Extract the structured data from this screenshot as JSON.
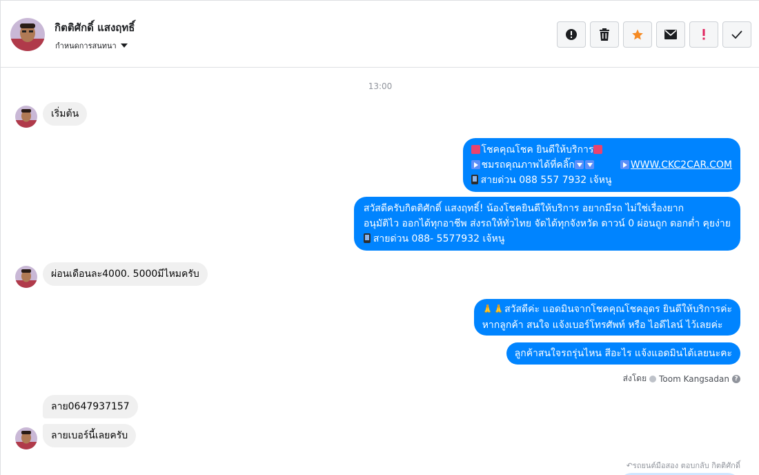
{
  "header": {
    "name": "กิตติศักดิ์ แสงฤทธิ์",
    "subtitle": "กำหนดการสนทนา",
    "actions": [
      {
        "name": "spam-button",
        "icon": "alert-circle-icon"
      },
      {
        "name": "delete-button",
        "icon": "trash-icon"
      },
      {
        "name": "star-button",
        "icon": "star-icon"
      },
      {
        "name": "mark-unread-button",
        "icon": "envelope-icon"
      },
      {
        "name": "priority-button",
        "icon": "exclamation-icon"
      },
      {
        "name": "done-button",
        "icon": "check-icon"
      }
    ]
  },
  "colors": {
    "outgoing": "#0084ff",
    "incoming": "#f0f0f0",
    "star": "#f58a23",
    "priority": "#e0245e"
  },
  "conversation": {
    "timestamp": "13:00",
    "msg_start": "เริ่มต้น",
    "auto_reply": {
      "line1": "โชคคุณโชค ยินดีให้บริการ",
      "line2a": "ชมรถคุณภาพได้ที่คลิ๊ก",
      "line2_link": "WWW.CKC2CAR.COM",
      "line3": "สายด่วน 088 557 7932 เจ้หนู"
    },
    "greeting": {
      "line1": "สวัสดีครับกิตติศักดิ์ แสงฤทธิ์! น้องโชคยินดีให้บริการ อยากมีรถ ไม่ใช่เรื่องยาก",
      "line2": "อนุมัติไว ออกได้ทุกอาชีพ ส่งรถให้ทั่วไทย จัดได้ทุกจังหวัด ดาวน์ 0  ผ่อนถูก ดอกต่ำ คุยง่าย",
      "line3": "สายด่วน 088- 5577932 เจ้หนู"
    },
    "msg_installment": "ผ่อนเดือนละ4000. 5000มีไหมครับ",
    "admin_reply": {
      "line1": "สวัสดีค่ะ แอดมินจากโชคคุณโชคอุดร ยินดีให้บริการค่ะ",
      "line2": "หากลูกค้า สนใจ แจ้งเบอร์โทรศัพท์ หรือ ไอดีไลน์  ไว้เลยค่ะ"
    },
    "admin_ask": "ลูกค้าสนใจรถรุ่นไหน สีอะไร แจ้งแอดมินได้เลยนะคะ",
    "sent_by_label": "ส่งโดย",
    "sent_by_name": "Toom Kangsadan",
    "help_glyph": "?",
    "msg_phone": "ลาย0647937157",
    "msg_number": "ลายเบอร์นี้เลยครับ",
    "reply_note": "รถยนต์มือสอง ตอบกลับ กิตติศักดิ์"
  }
}
